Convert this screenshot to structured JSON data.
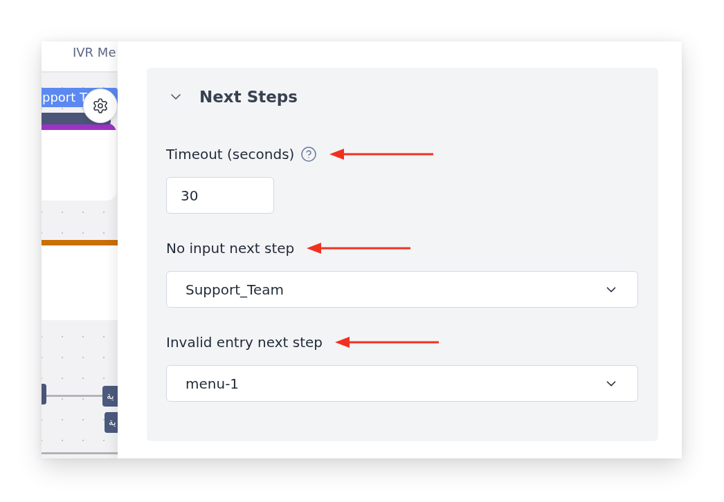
{
  "canvas": {
    "tab": {
      "label": "IVR Me",
      "selected": true
    },
    "nodes": [
      {
        "color": "#9b34c6",
        "tags": [
          {
            "text": "pport T",
            "color": "#5b89f1"
          },
          {
            "color": "#4a5577"
          }
        ]
      },
      {
        "color": "#c96f05"
      }
    ],
    "branch_labels": [
      "ية",
      "ية"
    ]
  },
  "panel": {
    "section": {
      "title": "Next Steps",
      "expanded": true,
      "fields": [
        {
          "kind": "number",
          "label": "Timeout (seconds)",
          "help": true,
          "annotated": true,
          "value": "30"
        },
        {
          "kind": "select",
          "label": "No input next step",
          "help": false,
          "annotated": true,
          "value": "Support_Team"
        },
        {
          "kind": "select",
          "label": "Invalid entry next step",
          "help": false,
          "annotated": true,
          "value": "menu-1"
        }
      ]
    }
  }
}
